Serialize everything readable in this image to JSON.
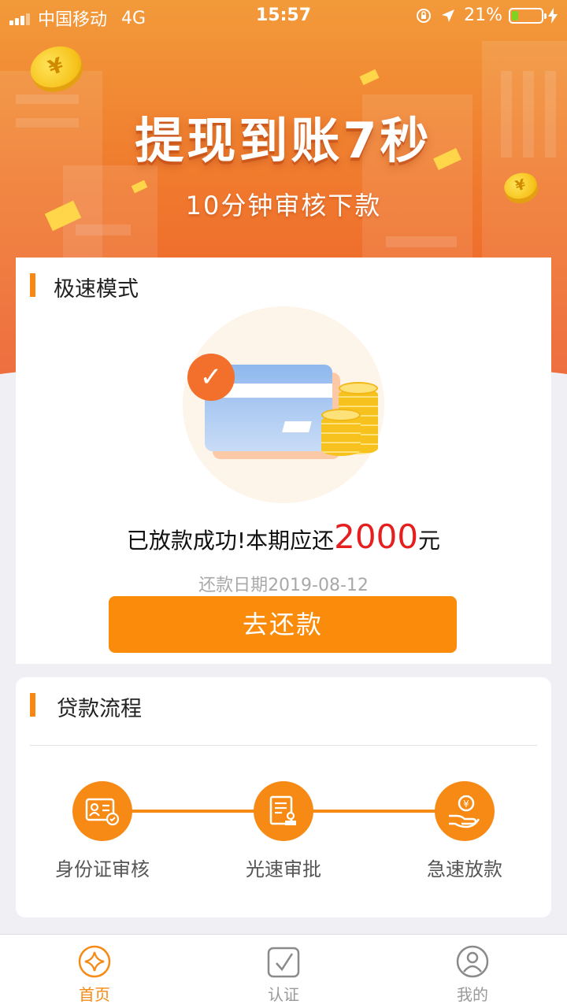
{
  "status_bar": {
    "carrier": "中国移动",
    "network": "4G",
    "time": "15:57",
    "battery_percent": "21%",
    "battery_level": 0.21
  },
  "banner": {
    "title": "提现到账7秒",
    "subtitle": "10分钟审核下款"
  },
  "speed_card": {
    "title": "极速模式",
    "message_prefix": "已放款成功!本期应还",
    "amount": "2000",
    "unit": "元",
    "due_date": "还款日期2019-08-12",
    "repay_button": "去还款",
    "amount_color": "#e61e1e"
  },
  "process_card": {
    "title": "贷款流程",
    "steps": [
      {
        "label": "身份证审核",
        "icon": "id-card-icon"
      },
      {
        "label": "光速审批",
        "icon": "approval-document-icon"
      },
      {
        "label": "急速放款",
        "icon": "money-hand-icon"
      }
    ]
  },
  "tab_bar": {
    "tabs": [
      {
        "label": "首页",
        "icon": "home-star-icon",
        "active": true
      },
      {
        "label": "认证",
        "icon": "certify-check-icon",
        "active": false
      },
      {
        "label": "我的",
        "icon": "profile-icon",
        "active": false
      }
    ]
  },
  "colors": {
    "accent": "#f68a14",
    "button": "#fb8b0a",
    "banner_top": "#f29a3a",
    "banner_bottom": "#ec5a2a"
  }
}
